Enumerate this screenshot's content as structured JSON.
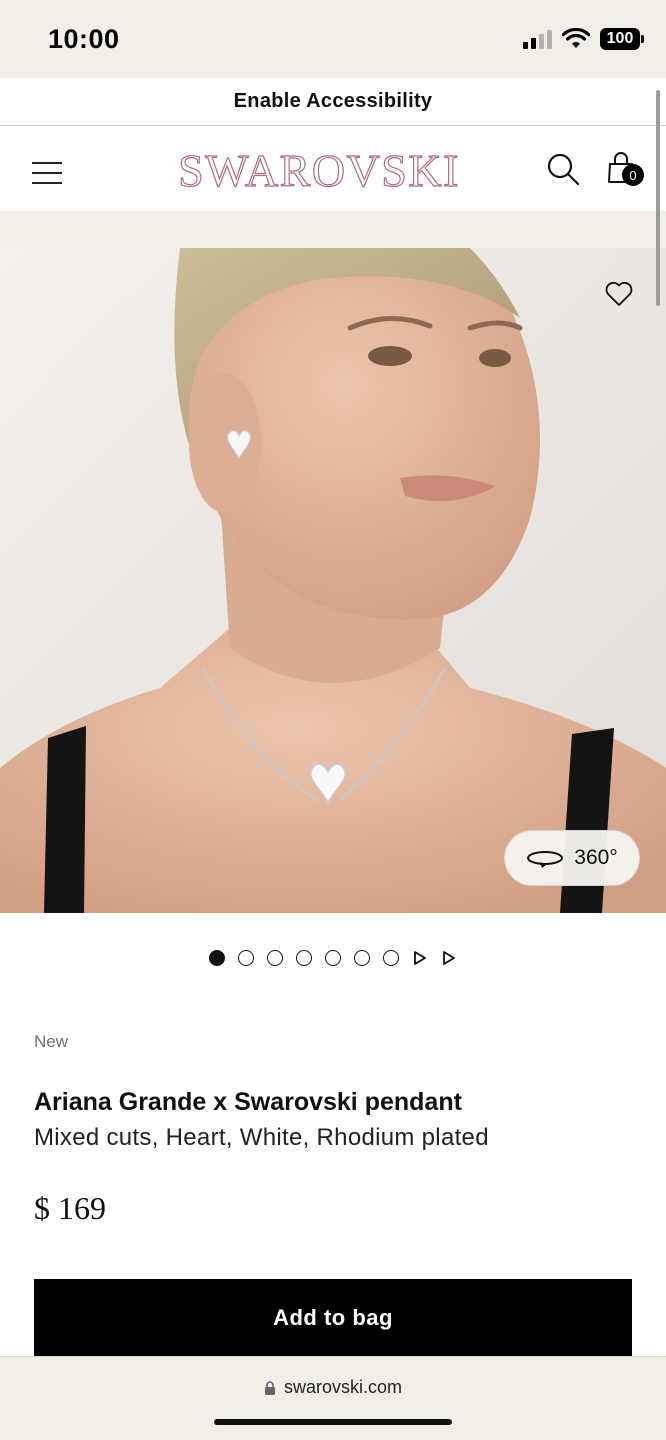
{
  "status_bar": {
    "time": "10:00",
    "battery": "100"
  },
  "accessibility": {
    "label": "Enable Accessibility"
  },
  "header": {
    "brand": "SWAROVSKI",
    "bag_count": "0",
    "icons": [
      "menu-icon",
      "search-icon",
      "shopping-bag-icon"
    ]
  },
  "hero": {
    "view_360_label": "360°",
    "icons": [
      "heart-icon",
      "rotate-360-icon"
    ]
  },
  "carousel": {
    "image_count": 7,
    "video_count": 2,
    "active_index": 0
  },
  "product": {
    "badge": "New",
    "name": "Ariana Grande x Swarovski pendant",
    "subtitle": "Mixed cuts, Heart, White, Rhodium plated",
    "price": "$ 169",
    "add_to_bag_label": "Add to bag"
  },
  "browser": {
    "url": "swarovski.com",
    "icons": [
      "lock-icon"
    ]
  },
  "colors": {
    "beige": "#f1eee8",
    "brand_rose": "#b06a80",
    "black": "#000000"
  }
}
